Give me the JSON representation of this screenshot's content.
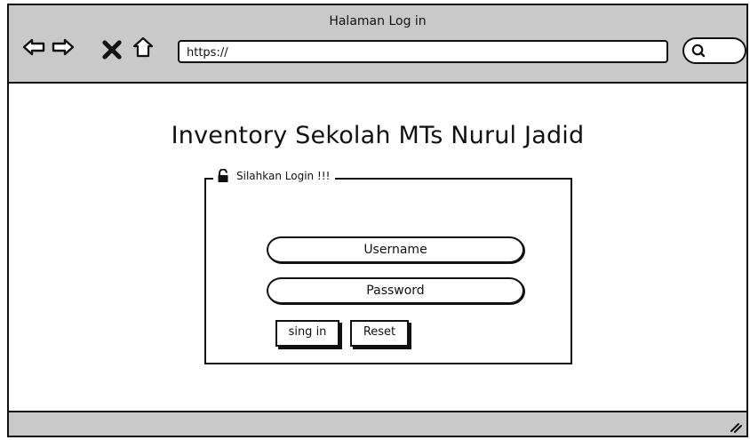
{
  "window": {
    "title": "Halaman Log in"
  },
  "toolbar": {
    "icons": [
      "back-arrow-icon",
      "forward-arrow-icon",
      "close-icon",
      "home-icon",
      "search-icon"
    ],
    "url_value": "https://"
  },
  "main": {
    "title": "Inventory Sekolah MTs Nurul Jadid",
    "login": {
      "legend": "Silahkan Login !!!",
      "username_placeholder": "Username",
      "password_placeholder": "Password",
      "sign_in_label": "sing in",
      "reset_label": "Reset"
    }
  },
  "statusbar": {
    "icon": "resize-grip-icon"
  },
  "colors": {
    "chrome": "#c9c9c9",
    "border": "#111111",
    "surface": "#ffffff"
  }
}
